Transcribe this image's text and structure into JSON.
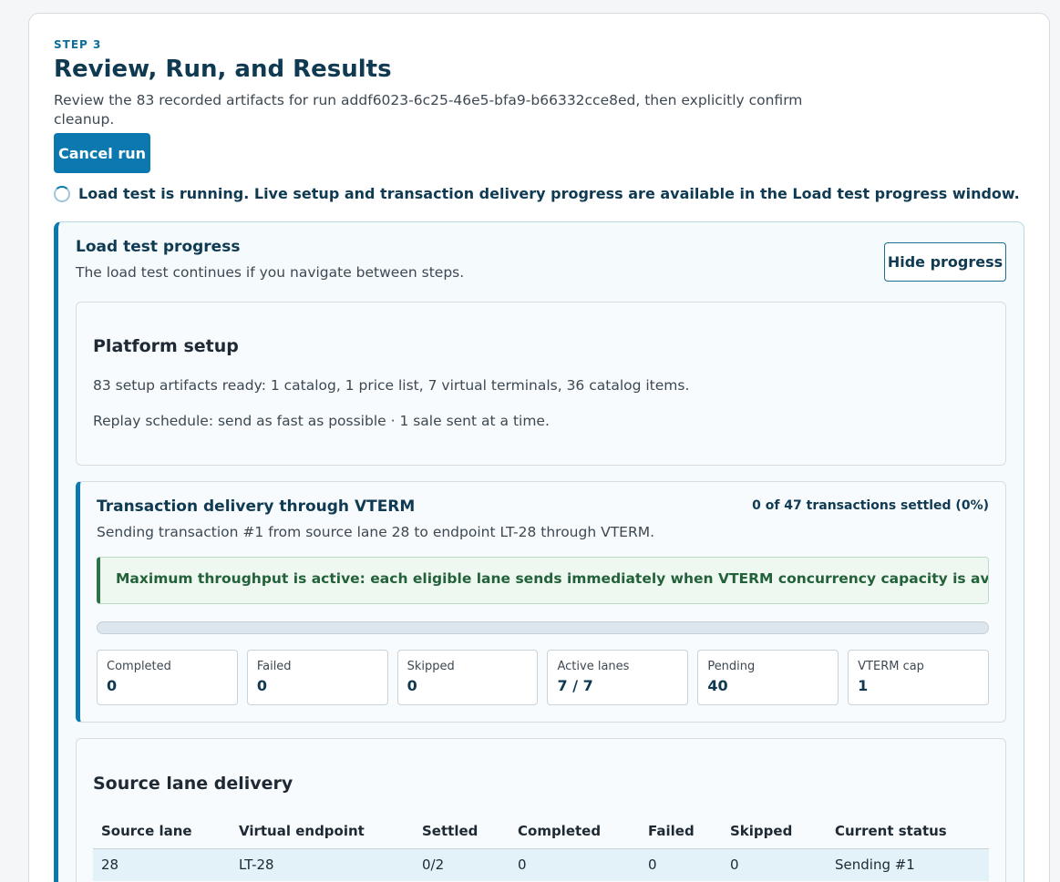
{
  "step": {
    "label": "STEP 3",
    "title": "Review, Run, and Results",
    "description": "Review the 83 recorded artifacts for run addf6023-6c25-46e5-bfa9-b66332cce8ed, then explicitly confirm cleanup.",
    "cancel_label": "Cancel run",
    "status_message": "Load test is running. Live setup and transaction delivery progress are available in the Load test progress window."
  },
  "progress": {
    "title": "Load test progress",
    "subtitle": "The load test continues if you navigate between steps.",
    "hide_label": "Hide progress"
  },
  "setup": {
    "title": "Platform setup",
    "artifacts_line": "83 setup artifacts ready: 1 catalog, 1 price list, 7 virtual terminals, 36 catalog items.",
    "schedule_line": "Replay schedule: send as fast as possible · 1 sale sent at a time."
  },
  "delivery": {
    "title": "Transaction delivery through VTERM",
    "settled_summary": "0 of 47 transactions settled (0%)",
    "settled_fraction": 0,
    "current_line": "Sending transaction #1 from source lane 28 to endpoint LT-28 through VTERM.",
    "notice": "Maximum throughput is active: each eligible lane sends immediately when VTERM concurrency capacity is available.",
    "stats": [
      {
        "label": "Completed",
        "value": "0"
      },
      {
        "label": "Failed",
        "value": "0"
      },
      {
        "label": "Skipped",
        "value": "0"
      },
      {
        "label": "Active lanes",
        "value": "7 / 7"
      },
      {
        "label": "Pending",
        "value": "40"
      },
      {
        "label": "VTERM cap",
        "value": "1"
      }
    ]
  },
  "lanes": {
    "title": "Source lane delivery",
    "columns": [
      "Source lane",
      "Virtual endpoint",
      "Settled",
      "Completed",
      "Failed",
      "Skipped",
      "Current status"
    ],
    "rows": [
      [
        "28",
        "LT-28",
        "0/2",
        "0",
        "0",
        "0",
        "Sending #1"
      ]
    ]
  },
  "colors": {
    "accent": "#0b79b0",
    "heading": "#0f3a52",
    "success": "#23613a"
  }
}
